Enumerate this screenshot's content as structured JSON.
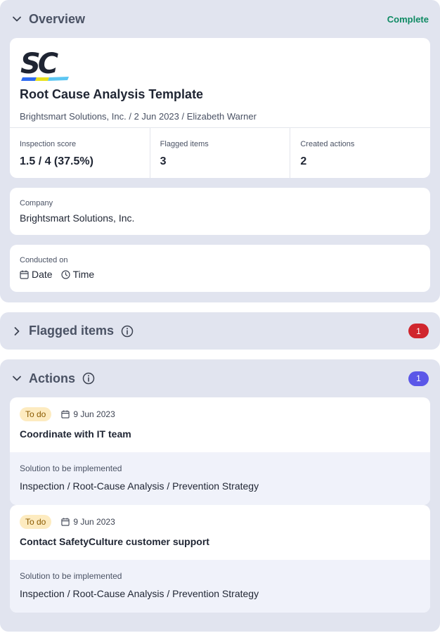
{
  "overview": {
    "title": "Overview",
    "status": "Complete",
    "logo_text": "SC",
    "template_title": "Root Cause Analysis Template",
    "meta": "Brightsmart Solutions, Inc. / 2 Jun 2023 / Elizabeth Warner",
    "stats": [
      {
        "label": "Inspection score",
        "value": "1.5 / 4 (37.5%)"
      },
      {
        "label": "Flagged items",
        "value": "3"
      },
      {
        "label": "Created actions",
        "value": "2"
      }
    ],
    "company": {
      "label": "Company",
      "value": "Brightsmart Solutions, Inc."
    },
    "conducted": {
      "label": "Conducted on",
      "date_label": "Date",
      "time_label": "Time"
    }
  },
  "flagged": {
    "title": "Flagged items",
    "count": "1",
    "badge_color": "#d0262e"
  },
  "actions": {
    "title": "Actions",
    "count": "1",
    "badge_color": "#5b57e8",
    "items": [
      {
        "status": "To do",
        "due": "9 Jun 2023",
        "title": "Coordinate with IT team",
        "solution_label": "Solution to be implemented",
        "path": "Inspection / Root-Cause Analysis / Prevention Strategy"
      },
      {
        "status": "To do",
        "due": "9 Jun 2023",
        "title": "Contact SafetyCulture customer support",
        "solution_label": "Solution to be implemented",
        "path": "Inspection / Root-Cause Analysis / Prevention Strategy"
      }
    ]
  },
  "colors": {
    "panel_bg": "#e1e4ef",
    "complete": "#0e8a63",
    "todo_bg": "#fdebc0"
  },
  "icons": [
    "chevron-down-icon",
    "chevron-right-icon",
    "info-icon",
    "calendar-icon",
    "clock-icon"
  ]
}
